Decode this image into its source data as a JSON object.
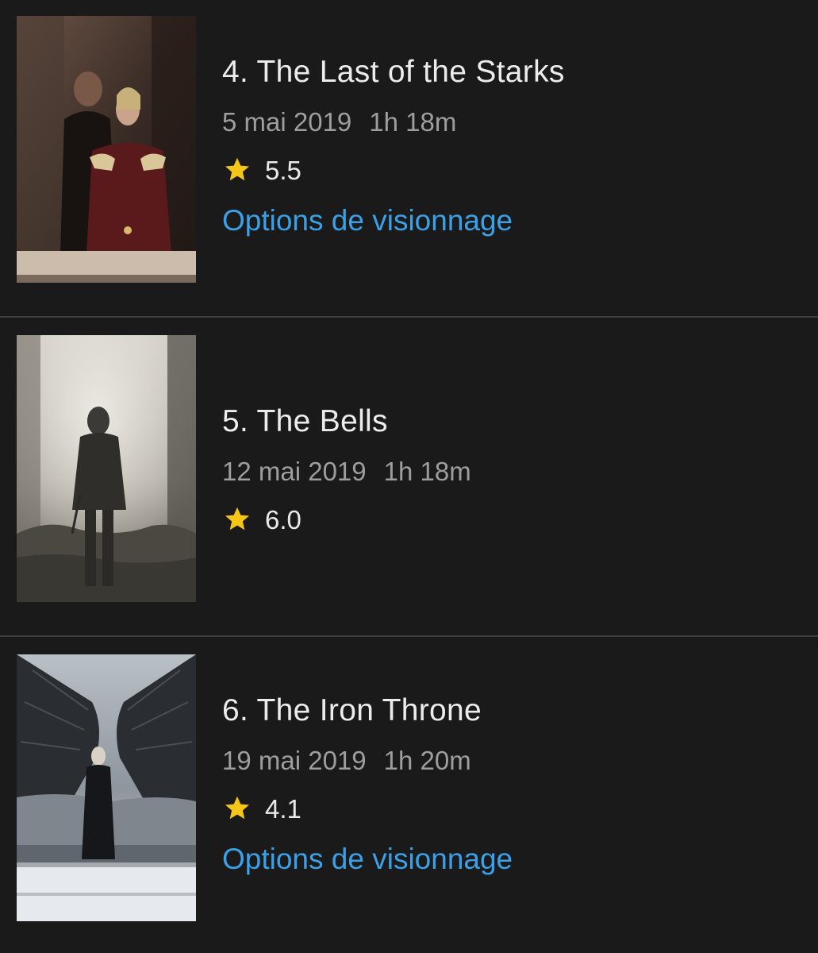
{
  "episodes": [
    {
      "title": "4. The Last of the Starks",
      "date": "5 mai 2019",
      "runtime": "1h 18m",
      "rating": "5.5",
      "options_label": "Options de visionnage",
      "thumbnail": "Woman in red dress with man behind her on balcony"
    },
    {
      "title": "5. The Bells",
      "date": "12 mai 2019",
      "runtime": "1h 18m",
      "rating": "6.0",
      "options_label": null,
      "thumbnail": "Hooded figure standing amid rubble and dust"
    },
    {
      "title": "6. The Iron Throne",
      "date": "19 mai 2019",
      "runtime": "1h 20m",
      "rating": "4.1",
      "options_label": "Options de visionnage",
      "thumbnail": "Figure standing before dragon wings in snowy ruins"
    }
  ],
  "colors": {
    "background": "#1a1a1a",
    "link": "#3aa0e8",
    "star": "#f5c518",
    "secondary_text": "#9e9e9e"
  },
  "icons": {
    "rating": "star-icon"
  }
}
